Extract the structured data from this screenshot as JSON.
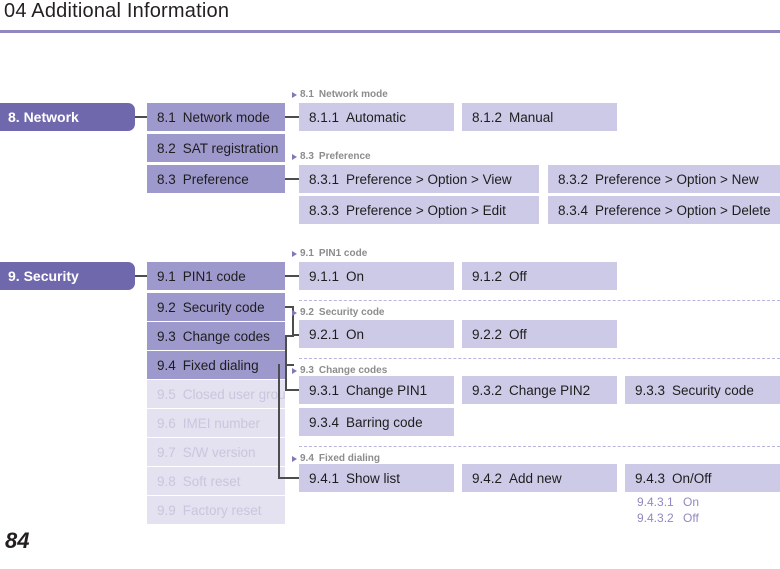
{
  "header": {
    "title": "04 Additional Information"
  },
  "footer": {
    "page_number": "84"
  },
  "colors": {
    "rule": "#9089c0",
    "level1_bg": "#6f68ad",
    "level2_bg": "#9e99cd",
    "level2_faded_bg": "#e4e2f0",
    "level3_bg": "#cdcae7",
    "level4_text": "#8f89c2",
    "caption_text": "#8c8c8c",
    "connector": "#4d4d4d",
    "dashed_rule": "#b9b5de"
  },
  "sections": [
    {
      "id": "network",
      "title": "8. Network",
      "items": [
        {
          "num": "8.1",
          "label": "Network mode",
          "faded": false
        },
        {
          "num": "8.2",
          "label": "SAT registration",
          "faded": false
        },
        {
          "num": "8.3",
          "label": "Preference",
          "faded": false
        }
      ],
      "groups": [
        {
          "caption_num": "8.1",
          "caption_label": "Network mode",
          "leaves": [
            {
              "num": "8.1.1",
              "label": "Automatic"
            },
            {
              "num": "8.1.2",
              "label": "Manual"
            }
          ]
        },
        {
          "caption_num": "8.3",
          "caption_label": "Preference",
          "leaves": [
            {
              "num": "8.3.1",
              "label": "Preference > Option > View"
            },
            {
              "num": "8.3.2",
              "label": "Preference > Option > New"
            },
            {
              "num": "8.3.3",
              "label": "Preference > Option > Edit"
            },
            {
              "num": "8.3.4",
              "label": "Preference > Option > Delete"
            }
          ]
        }
      ]
    },
    {
      "id": "security",
      "title": "9. Security",
      "items": [
        {
          "num": "9.1",
          "label": "PIN1 code",
          "faded": false
        },
        {
          "num": "9.2",
          "label": "Security code",
          "faded": false
        },
        {
          "num": "9.3",
          "label": "Change codes",
          "faded": false
        },
        {
          "num": "9.4",
          "label": "Fixed dialing",
          "faded": false
        },
        {
          "num": "9.5",
          "label": "Closed user group",
          "faded": true
        },
        {
          "num": "9.6",
          "label": "IMEI number",
          "faded": true
        },
        {
          "num": "9.7",
          "label": "S/W version",
          "faded": true
        },
        {
          "num": "9.8",
          "label": "Soft reset",
          "faded": true
        },
        {
          "num": "9.9",
          "label": "Factory reset",
          "faded": true
        }
      ],
      "groups": [
        {
          "caption_num": "9.1",
          "caption_label": "PIN1 code",
          "leaves": [
            {
              "num": "9.1.1",
              "label": "On"
            },
            {
              "num": "9.1.2",
              "label": "Off"
            }
          ]
        },
        {
          "caption_num": "9.2",
          "caption_label": "Security code",
          "leaves": [
            {
              "num": "9.2.1",
              "label": "On"
            },
            {
              "num": "9.2.2",
              "label": "Off"
            }
          ]
        },
        {
          "caption_num": "9.3",
          "caption_label": "Change codes",
          "leaves": [
            {
              "num": "9.3.1",
              "label": "Change PIN1"
            },
            {
              "num": "9.3.2",
              "label": "Change PIN2"
            },
            {
              "num": "9.3.3",
              "label": "Security code"
            },
            {
              "num": "9.3.4",
              "label": "Barring code"
            }
          ]
        },
        {
          "caption_num": "9.4",
          "caption_label": "Fixed dialing",
          "leaves": [
            {
              "num": "9.4.1",
              "label": "Show list"
            },
            {
              "num": "9.4.2",
              "label": "Add new"
            },
            {
              "num": "9.4.3",
              "label": "On/Off"
            }
          ],
          "subleaves": [
            {
              "num": "9.4.3.1",
              "label": "On"
            },
            {
              "num": "9.4.3.2",
              "label": "Off"
            }
          ]
        }
      ]
    }
  ]
}
